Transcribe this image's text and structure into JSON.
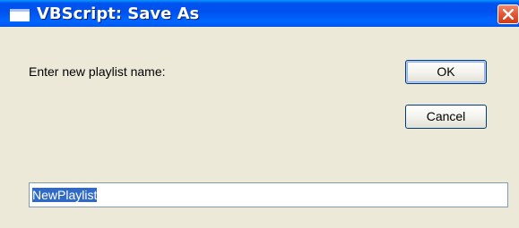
{
  "window": {
    "title": "VBScript: Save As",
    "close_icon": "close-x-icon",
    "app_icon": "window-icon"
  },
  "dialog": {
    "prompt": "Enter new playlist name:",
    "ok_label": "OK",
    "cancel_label": "Cancel",
    "input_value": "NewPlaylist",
    "input_selected": true
  },
  "colors": {
    "titlebar": "#0054e3",
    "close_button": "#e45a3a",
    "background": "#ece9d8",
    "selection": "#316ac5"
  }
}
